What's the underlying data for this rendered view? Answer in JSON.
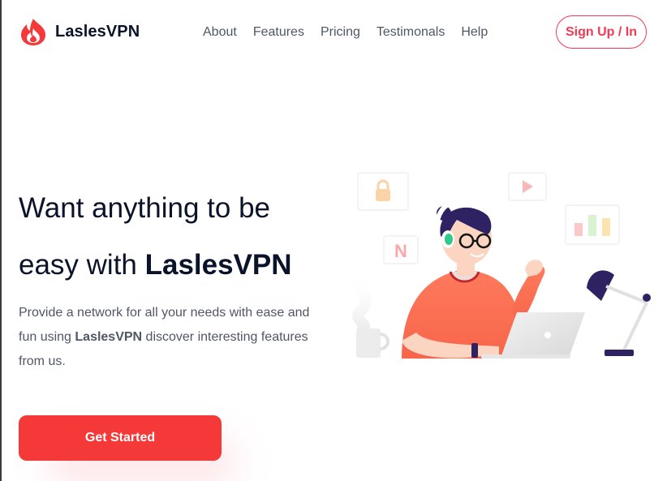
{
  "brand": {
    "name": "LaslesVPN",
    "accent_color": "#f53838"
  },
  "nav": {
    "items": [
      {
        "label": "About"
      },
      {
        "label": "Features"
      },
      {
        "label": "Pricing"
      },
      {
        "label": "Testimonals"
      },
      {
        "label": "Help"
      }
    ]
  },
  "auth": {
    "signup_label": "Sign Up / In"
  },
  "hero": {
    "title_line1": "Want anything to be",
    "title_line2_prefix": "easy with ",
    "title_line2_brand": "LaslesVPN",
    "desc_part1": "Provide a network for all your needs with ease and fun using ",
    "desc_brand": "LaslesVPN",
    "desc_part2": " discover interesting features from us.",
    "cta_label": "Get Started"
  },
  "illustration": {
    "floating_icons": [
      "lock-icon",
      "play-icon",
      "netflix-icon",
      "bar-chart-icon"
    ],
    "netflix_letter": "N"
  }
}
